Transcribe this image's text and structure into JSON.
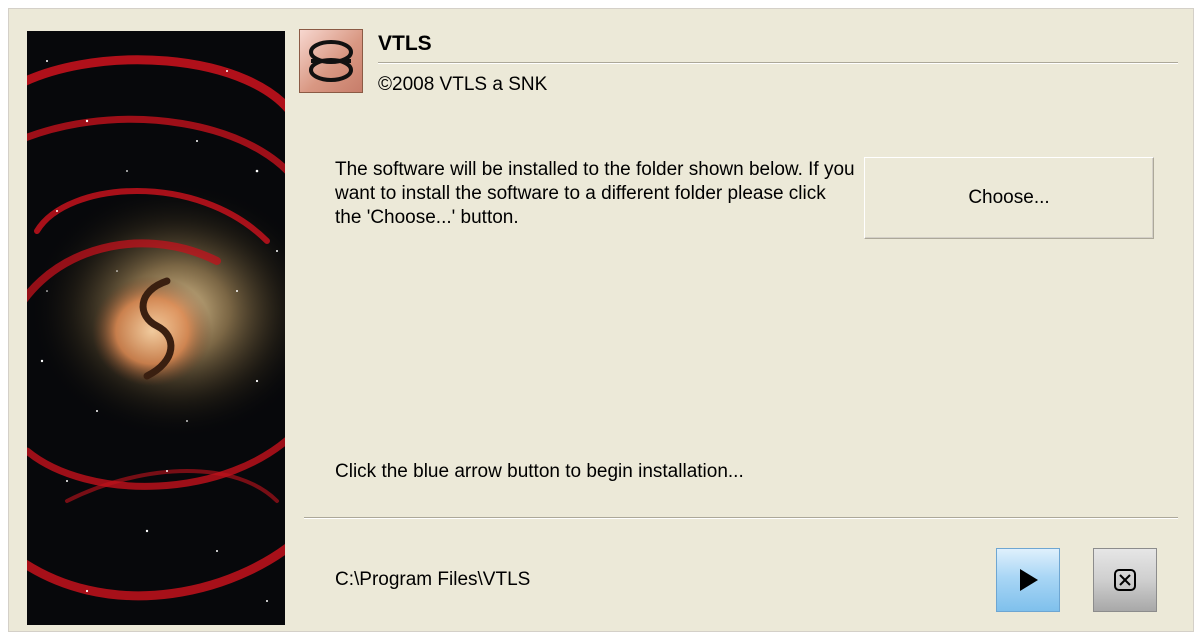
{
  "header": {
    "title": "VTLS",
    "copyright": "©2008 VTLS a SNK"
  },
  "body": {
    "description": "The software will be installed to the folder shown below.  If you want to install the software to a different folder please click the 'Choose...' button.",
    "hint": "Click the blue arrow button to begin installation...",
    "install_path": "C:\\Program Files\\VTLS"
  },
  "buttons": {
    "choose_label": "Choose...",
    "run_icon": "play-arrow-icon",
    "cancel_icon": "close-box-icon"
  },
  "icons": {
    "app_logo": "vtls-logo-icon",
    "side_art": "spiral-galaxy-image"
  },
  "colors": {
    "dialog_bg": "#ece9d8",
    "run_button": "#a9d6f5",
    "cancel_button": "#cfcfcf"
  }
}
